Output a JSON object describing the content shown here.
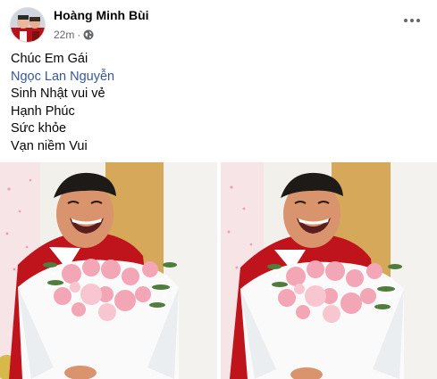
{
  "post": {
    "author_name": "Hoàng Minh Bùi",
    "timestamp": "22m",
    "separator": "·",
    "privacy_icon": "globe-icon",
    "more_icon": "more-options-icon",
    "message_lines": [
      "Chúc Em Gái",
      "Ngọc Lan Nguyễn",
      "Sinh Nhật vui vẻ",
      "Hạnh Phúc",
      "Sức khỏe",
      "Vạn niềm Vui"
    ],
    "mention_index": 1,
    "colors": {
      "mention": "#385898",
      "secondary_text": "#65676b",
      "wall": "#f2f0eb",
      "door": "#d6a85a",
      "shirt": "#c0141c",
      "wrap": "#fafafa",
      "rose": "#f2a6b6"
    },
    "photos": [
      {
        "name": "photo-left"
      },
      {
        "name": "photo-right"
      }
    ]
  }
}
